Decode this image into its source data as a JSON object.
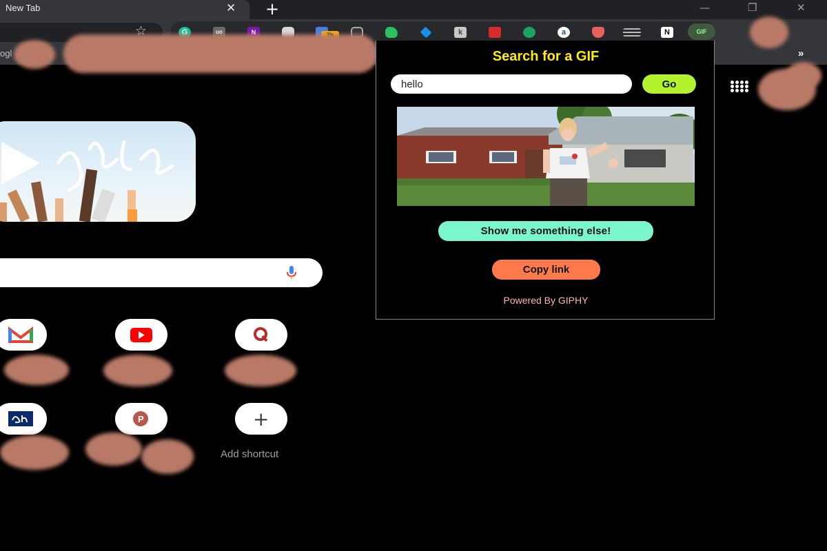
{
  "browser": {
    "tab_title": "New Tab",
    "tab_close_glyph": "✕",
    "new_tab_glyph": "+",
    "window_controls": {
      "minimize": "—",
      "restore": "❐",
      "close": "✕"
    },
    "extension_badge": "7h",
    "bookmarks_more": "»",
    "bookmark_partial_label": "ogl"
  },
  "page": {
    "shortcut_add_label": "Add shortcut",
    "add_glyph": "+"
  },
  "popup": {
    "title": "Search for a GIF",
    "search_value": "hello",
    "go_label": "Go",
    "else_label": "Show me something else!",
    "copy_label": "Copy link",
    "powered_by": "Powered By GIPHY"
  },
  "colors": {
    "popup_title": "#ffee00",
    "go_button": "#b4f22d",
    "else_button": "#7bf5cc",
    "copy_button": "#ff7a4a",
    "powered_text": "#ffb6b0"
  }
}
